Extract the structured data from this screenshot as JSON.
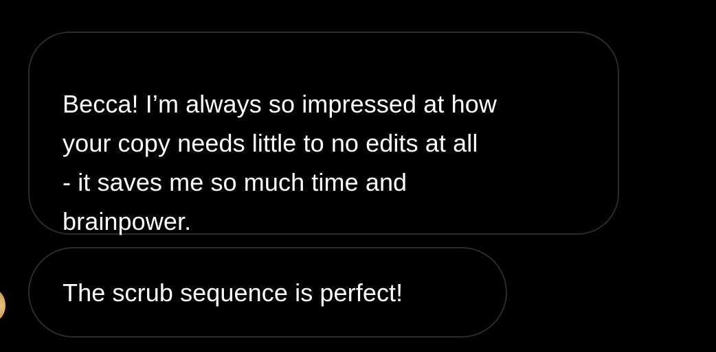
{
  "conversation": {
    "messages": [
      {
        "lines": [
          "Becca! I’m always so impressed at how",
          "your copy needs little to no edits at all",
          "- it saves me so much time and",
          "brainpower."
        ]
      },
      {
        "text": "The scrub sequence is perfect!"
      }
    ]
  },
  "colors": {
    "background": "#000000",
    "bubble_border": "#2b2b2d",
    "text": "#ffffff",
    "avatar": "#c99a55"
  },
  "icons": {
    "avatar": "sender-avatar"
  }
}
